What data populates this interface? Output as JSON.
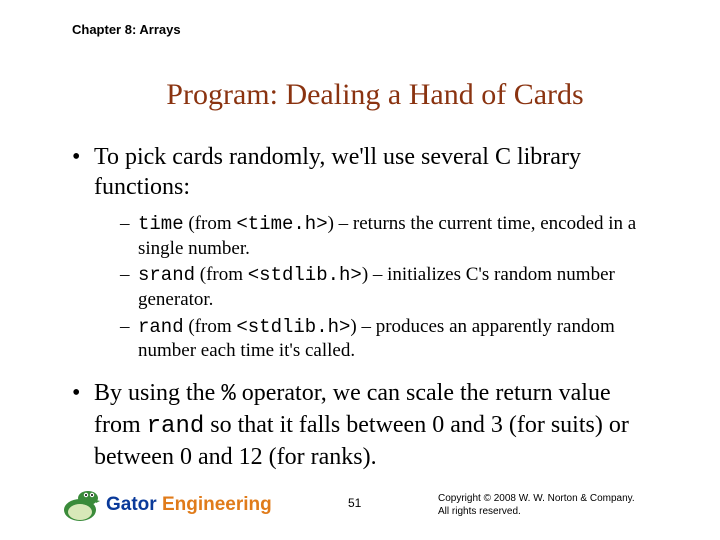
{
  "chapter": "Chapter 8: Arrays",
  "title": "Program: Dealing a Hand of Cards",
  "bullet_intro": "To pick cards randomly, we'll use several C library functions:",
  "funcs": {
    "time": {
      "name": "time",
      "header": "<time.h>",
      "desc": ") – returns the current time, encoded in a single number."
    },
    "srand": {
      "name": "srand",
      "header": "<stdlib.h>",
      "desc": ") – initializes C's random number generator."
    },
    "rand": {
      "name": "rand",
      "header": "<stdlib.h>",
      "desc": ") – produces an apparently random number each time it's called."
    }
  },
  "from_label": " (from ",
  "bullet_scale_a": "By using the ",
  "op": "%",
  "bullet_scale_b": " operator, we can scale the return value from ",
  "rand_inline": "rand",
  "bullet_scale_c": " so that it falls between 0 and 3 (for suits) or between 0 and 12 (for ranks).",
  "footer": {
    "gator_g": "Gator ",
    "gator_e": "Engineering",
    "page": "51",
    "copy1": "Copyright © 2008 W. W. Norton & Company.",
    "copy2": "All rights reserved."
  }
}
